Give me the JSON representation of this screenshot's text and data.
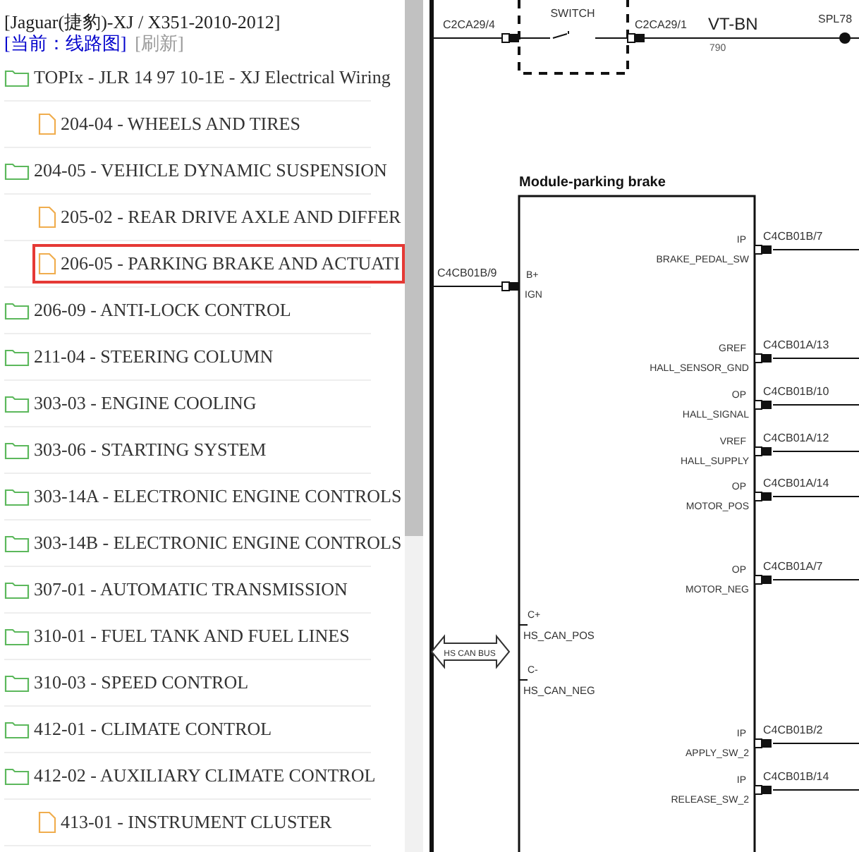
{
  "header": {
    "vehicle": "[Jaguar(捷豹)-XJ / X351-2010-2012]",
    "current": "[当前：线路图]",
    "refresh": "[刷新]"
  },
  "tree": [
    {
      "label": "TOPIx - JLR 14 97 10-1E - XJ Electrical Wiring",
      "kind": "folder",
      "selected": false,
      "children": [
        {
          "label": "204-04 - WHEELS AND TIRES",
          "kind": "file",
          "selected": false
        }
      ]
    },
    {
      "label": "204-05 - VEHICLE DYNAMIC SUSPENSION",
      "kind": "folder",
      "selected": false,
      "children": [
        {
          "label": "205-02 - REAR DRIVE AXLE AND DIFFER",
          "kind": "file",
          "selected": false
        },
        {
          "label": "206-05 - PARKING BRAKE AND ACTUATI",
          "kind": "file",
          "selected": true
        }
      ]
    },
    {
      "label": "206-09 - ANTI-LOCK CONTROL",
      "kind": "folder",
      "selected": false
    },
    {
      "label": "211-04 - STEERING COLUMN",
      "kind": "folder",
      "selected": false
    },
    {
      "label": "303-03 - ENGINE COOLING",
      "kind": "folder",
      "selected": false
    },
    {
      "label": "303-06 - STARTING SYSTEM",
      "kind": "folder",
      "selected": false
    },
    {
      "label": "303-14A - ELECTRONIC ENGINE CONTROLS",
      "kind": "folder",
      "selected": false
    },
    {
      "label": "303-14B - ELECTRONIC ENGINE CONTROLS",
      "kind": "folder",
      "selected": false
    },
    {
      "label": "307-01 - AUTOMATIC TRANSMISSION",
      "kind": "folder",
      "selected": false
    },
    {
      "label": "310-01 - FUEL TANK AND FUEL LINES",
      "kind": "folder",
      "selected": false
    },
    {
      "label": "310-03 - SPEED CONTROL",
      "kind": "folder",
      "selected": false
    },
    {
      "label": "412-01 - CLIMATE CONTROL",
      "kind": "folder",
      "selected": false
    },
    {
      "label": "412-02 - AUXILIARY CLIMATE CONTROL",
      "kind": "folder",
      "selected": false,
      "children": [
        {
          "label": "413-01 - INSTRUMENT CLUSTER",
          "kind": "file",
          "selected": false
        }
      ]
    }
  ],
  "diagram": {
    "switch": "SWITCH",
    "connector_in": "C2CA29/4",
    "connector_out": "C2CA29/1",
    "wire_color": "VT-BN",
    "wire_number": "790",
    "splice": "SPL78",
    "module_title": "Module-parking brake",
    "left_pin": {
      "connector": "C4CB01B/9",
      "function": "B+",
      "signal": "IGN"
    },
    "can_bus": "HS CAN BUS",
    "can_pins": [
      {
        "function": "C+",
        "signal": "HS_CAN_POS"
      },
      {
        "function": "C-",
        "signal": "HS_CAN_NEG"
      }
    ],
    "right_pins": [
      {
        "function": "IP",
        "signal": "BRAKE_PEDAL_SW",
        "connector": "C4CB01B/7"
      },
      {
        "function": "GREF",
        "signal": "HALL_SENSOR_GND",
        "connector": "C4CB01A/13"
      },
      {
        "function": "OP",
        "signal": "HALL_SIGNAL",
        "connector": "C4CB01B/10"
      },
      {
        "function": "VREF",
        "signal": "HALL_SUPPLY",
        "connector": "C4CB01A/12"
      },
      {
        "function": "OP",
        "signal": "MOTOR_POS",
        "connector": "C4CB01A/14"
      },
      {
        "function": "OP",
        "signal": "MOTOR_NEG",
        "connector": "C4CB01A/7"
      },
      {
        "function": "IP",
        "signal": "APPLY_SW_2",
        "connector": "C4CB01B/2"
      },
      {
        "function": "IP",
        "signal": "RELEASE_SW_2",
        "connector": "C4CB01B/14"
      }
    ]
  }
}
